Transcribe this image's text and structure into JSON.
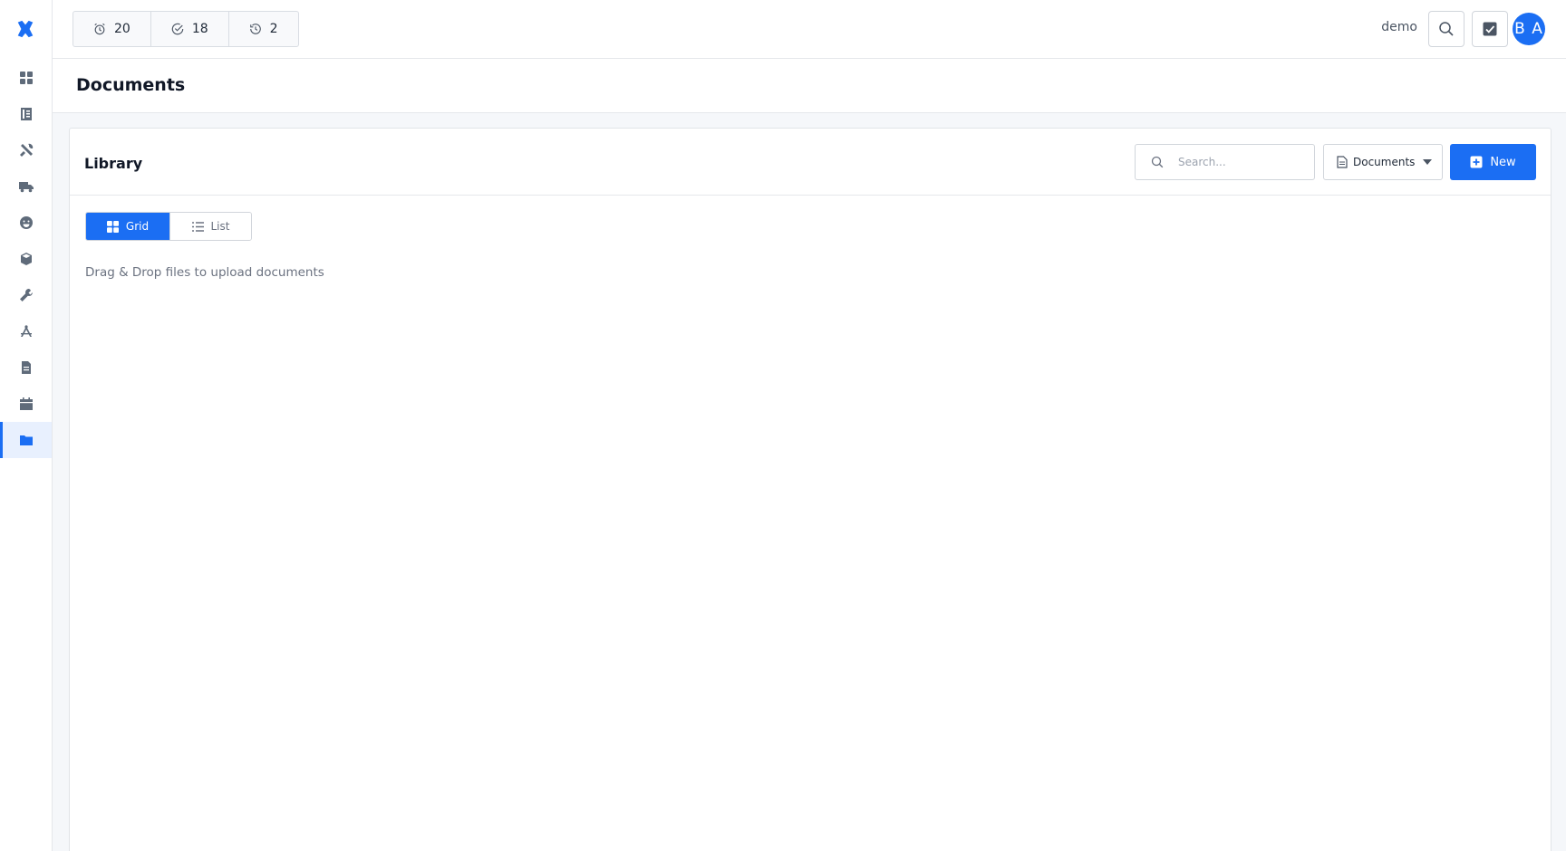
{
  "sidebar": {
    "logo_icon": "puzzle-logo-icon",
    "items": [
      {
        "name": "dashboard",
        "icon": "grid-icon",
        "active": false
      },
      {
        "name": "ledger",
        "icon": "book-icon",
        "active": false
      },
      {
        "name": "tools",
        "icon": "tools-icon",
        "active": false
      },
      {
        "name": "shipping",
        "icon": "truck-icon",
        "active": false
      },
      {
        "name": "customers",
        "icon": "smile-icon",
        "active": false
      },
      {
        "name": "inventory",
        "icon": "boxes-icon",
        "active": false
      },
      {
        "name": "maintenance",
        "icon": "wrench-icon",
        "active": false
      },
      {
        "name": "design",
        "icon": "compass-icon",
        "active": false
      },
      {
        "name": "reports",
        "icon": "file-icon",
        "active": false
      },
      {
        "name": "calendar",
        "icon": "calendar-icon",
        "active": false
      },
      {
        "name": "documents",
        "icon": "folder-icon",
        "active": true
      }
    ]
  },
  "topbar": {
    "counters": [
      {
        "icon": "alarm-clock-icon",
        "value": "20"
      },
      {
        "icon": "check-circle-icon",
        "value": "18"
      },
      {
        "icon": "clock-history-icon",
        "value": "2"
      }
    ],
    "user_label": "demo",
    "avatar_initials": "B A"
  },
  "page": {
    "title": "Documents"
  },
  "library": {
    "title": "Library",
    "search_placeholder": "Search...",
    "type_select_value": "Documents",
    "new_button_label": "New",
    "view_grid_label": "Grid",
    "view_list_label": "List",
    "hint_text": "Drag & Drop files to upload documents"
  },
  "colors": {
    "primary": "#1b6ef3",
    "text": "#1f2937",
    "muted": "#6b7280",
    "border": "#d1d5db",
    "background": "#f5f7fa"
  }
}
